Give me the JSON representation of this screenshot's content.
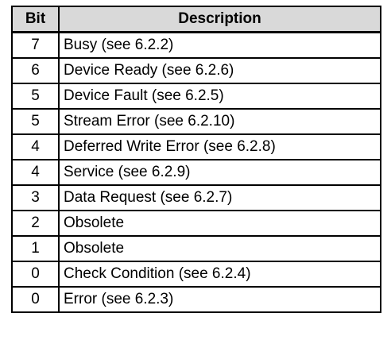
{
  "table": {
    "headers": {
      "bit": "Bit",
      "description": "Description"
    },
    "rows": [
      {
        "bit": "7",
        "description": "Busy (see 6.2.2)"
      },
      {
        "bit": "6",
        "description": "Device Ready (see 6.2.6)"
      },
      {
        "bit": "5",
        "description": "Device Fault (see 6.2.5)"
      },
      {
        "bit": "5",
        "description": "Stream Error (see 6.2.10)"
      },
      {
        "bit": "4",
        "description": "Deferred Write Error (see 6.2.8)"
      },
      {
        "bit": "4",
        "description": "Service (see 6.2.9)"
      },
      {
        "bit": "3",
        "description": "Data Request (see 6.2.7)"
      },
      {
        "bit": "2",
        "description": "Obsolete"
      },
      {
        "bit": "1",
        "description": "Obsolete"
      },
      {
        "bit": "0",
        "description": "Check Condition (see 6.2.4)"
      },
      {
        "bit": "0",
        "description": "Error (see 6.2.3)"
      }
    ]
  }
}
